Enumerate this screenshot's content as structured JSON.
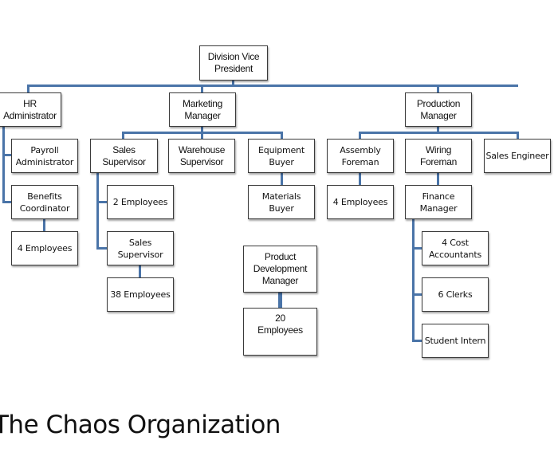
{
  "chart_title": "The Chaos Organization",
  "line_color": "#4a74a8",
  "nodes": {
    "division_vp": "Division Vice\nPresident",
    "hr_admin": "HR\nAdministrator",
    "marketing_manager": "Marketing\nManager",
    "production_manager": "Production\nManager",
    "payroll_admin": "Payroll\nAdministrator",
    "benefits_coordinator": "Benefits\nCoordinator",
    "hr_employees": "4 Employees",
    "sales_supervisor": "Sales\nSupervisor",
    "warehouse_supervisor": "Warehouse\nSupervisor",
    "equipment_buyer": "Equipment\nBuyer",
    "materials_buyer": "Materials\nBuyer",
    "sales_employees": "2 Employees",
    "sales_supervisor_2": "Sales\nSupervisor",
    "sales_38_employees": "38  Employees",
    "product_dev_manager": "Product\nDevelopment\nManager",
    "product_dev_employees": "20\nEmployees",
    "assembly_foreman": "Assembly\nForeman",
    "assembly_employees": "4 Employees",
    "wiring_foreman": "Wiring Foreman",
    "sales_engineer": "Sales Engineer",
    "finance_manager": "Finance\nManager",
    "cost_accountants": "4 Cost\nAccountants",
    "clerks": "6 Clerks",
    "student_intern": "Student Intern"
  }
}
